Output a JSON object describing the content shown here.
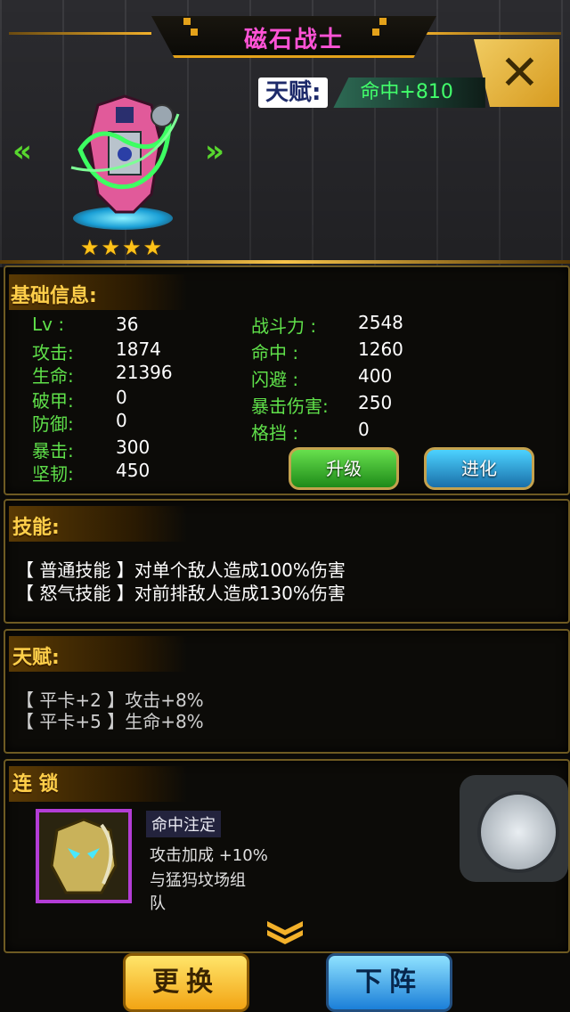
{
  "header": {
    "title": "磁石战士",
    "close_label": "✕"
  },
  "talent_tag": {
    "label": "天赋:",
    "value": "命中+810"
  },
  "hero": {
    "stars": 4,
    "prev_icon": "«",
    "next_icon": "»"
  },
  "basic_info": {
    "title": "基础信息:",
    "left_stats": [
      {
        "label": "Lv   :",
        "value": "36"
      },
      {
        "label": "攻击:",
        "value": "1874"
      },
      {
        "label": "生命:",
        "value": "21396"
      },
      {
        "label": "破甲:",
        "value": "0"
      },
      {
        "label": "防御:",
        "value": "0"
      },
      {
        "label": "暴击:",
        "value": "300"
      },
      {
        "label": "坚韧:",
        "value": "450"
      }
    ],
    "right_stats": [
      {
        "label": "战斗力 :",
        "value": "2548"
      },
      {
        "label": "命中   :",
        "value": "1260"
      },
      {
        "label": "闪避   :",
        "value": "400"
      },
      {
        "label": "暴击伤害:",
        "value": "250"
      },
      {
        "label": "格挡   :",
        "value": "0"
      }
    ],
    "upgrade_label": "升级",
    "evolve_label": "进化"
  },
  "skills": {
    "title": "技能:",
    "lines": [
      "【 普通技能 】对单个敌人造成100%伤害",
      "【 怒气技能 】对前排敌人造成130%伤害"
    ]
  },
  "talent": {
    "title": "天赋:",
    "lines": [
      "【 平卡+2 】攻击+8%",
      "【 平卡+5 】生命+8%"
    ]
  },
  "chain": {
    "title": "连 锁",
    "name": "命中注定",
    "lines": [
      "攻击加成   +10%",
      "与猛犸坟场组",
      "队"
    ]
  },
  "bottom": {
    "swap_label": "更换",
    "remove_label": "下阵"
  },
  "colors": {
    "accent": "#ffcf4a",
    "stat_label": "#5fe04a",
    "title": "#ff53d6"
  }
}
